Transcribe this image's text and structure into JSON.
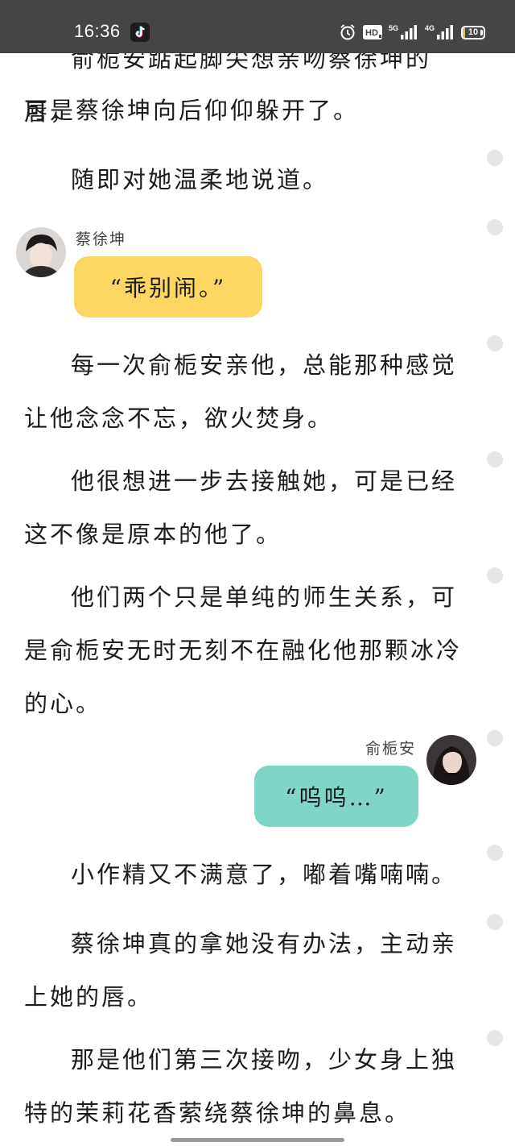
{
  "status_bar": {
    "time": "16:36",
    "hd_label": "HD",
    "network_1": "5G",
    "network_2": "4G",
    "battery_level": "10"
  },
  "story": {
    "paragraphs": [
      "俞栀安踮起脚尖想亲吻蔡徐坤的唇，",
      "可是蔡徐坤向后仰仰躲开了。",
      "随即对她温柔地说道。",
      "每一次俞栀安亲他，总能那种感觉让他念念不忘，欲火焚身。",
      "他很想进一步去接触她，可是已经这不像是原本的他了。",
      "他们两个只是单纯的师生关系，可是俞栀安无时无刻不在融化他那颗冰冷的心。",
      "小作精又不满意了，嘟着嘴喃喃。",
      "蔡徐坤真的拿她没有办法，主动亲上她的唇。",
      "那是他们第三次接吻，少女身上独特的茉莉花香萦绕蔡徐坤的鼻息。"
    ],
    "dialogues": [
      {
        "speaker": "蔡徐坤",
        "text": "“乖别闹。”",
        "color": "#fbd661"
      },
      {
        "speaker": "俞栀安",
        "text": "“呜呜…”",
        "color": "#7fd6c6"
      }
    ]
  },
  "colors": {
    "status_bar_bg": "#454545",
    "bubble_yellow": "#fbd661",
    "bubble_teal": "#7fd6c6",
    "comment_dot": "#e6e6e6"
  },
  "icons": [
    "tiktok-app-icon",
    "alarm-clock-icon",
    "hd-voice-icon",
    "signal-5g-icon",
    "signal-4g-icon",
    "battery-icon",
    "comment-dot-icon"
  ]
}
